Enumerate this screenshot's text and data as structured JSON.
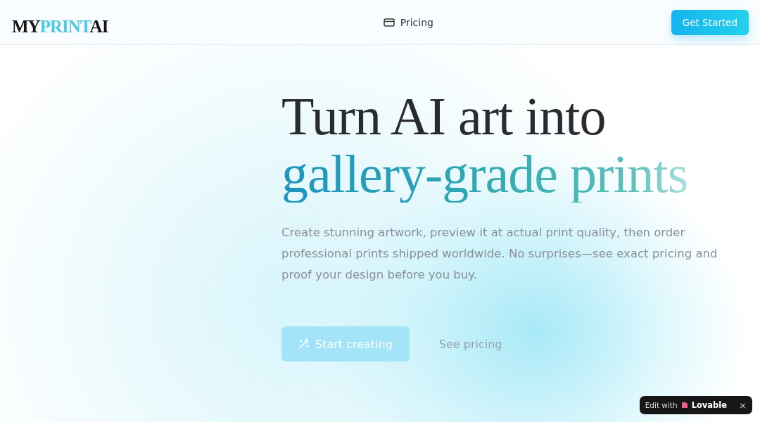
{
  "header": {
    "logo": {
      "prefix": "MY",
      "highlight": "PRINT",
      "suffix": "AI"
    },
    "nav_link": "Pricing",
    "cta": "Get Started"
  },
  "hero": {
    "title_line_1": "Turn AI art into",
    "title_line_2": "gallery-grade prints",
    "description": "Create stunning artwork, preview it at actual print quality, then order professional prints shipped worldwide. No surprises—see exact pricing and proof your design before you buy.",
    "primary_button": "Start creating",
    "secondary_button": "See pricing"
  },
  "badge": {
    "label": "Edit with",
    "brand": "Lovable",
    "close": "×"
  }
}
